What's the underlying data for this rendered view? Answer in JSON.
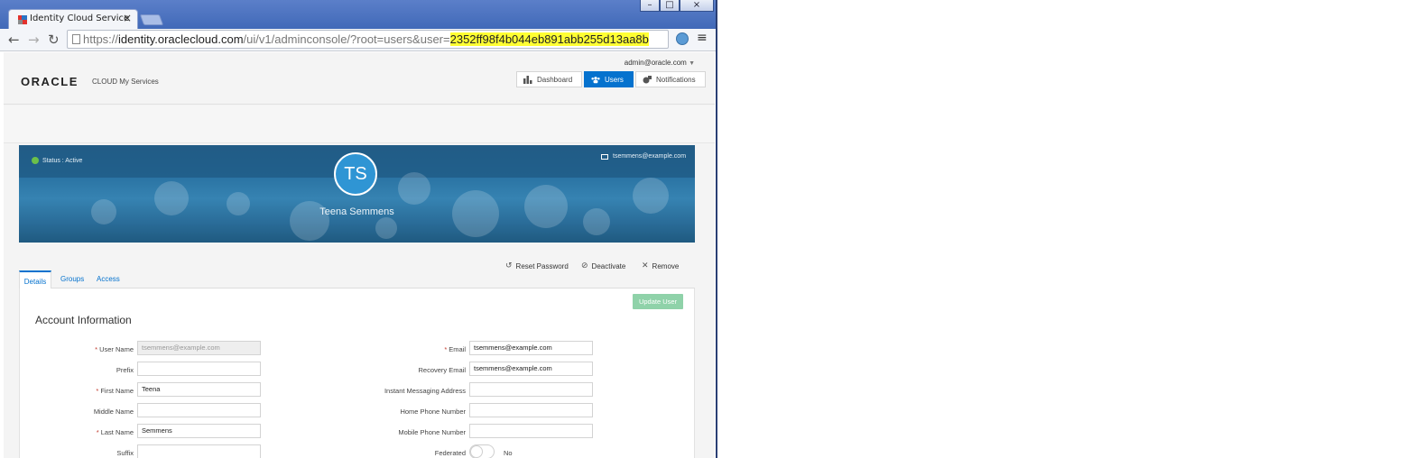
{
  "browser": {
    "tab_title": "Identity Cloud Service",
    "tab_close": "×",
    "url_scheme": "https://",
    "url_host": "identity.oraclecloud.com",
    "url_path": "/ui/v1/adminconsole/?root=users&user=",
    "url_highlight": "2352ff98f4b044eb891abb255d13aa8b",
    "window_controls": [
      "–",
      "□",
      "×"
    ],
    "icons": [
      "back-icon",
      "forward-icon",
      "reload-icon",
      "page-icon",
      "extension-icon",
      "menu-icon"
    ]
  },
  "header": {
    "admin_user": "admin@oracle.com",
    "logo_text": "ORACLE",
    "logo_suffix": "CLOUD My Services",
    "nav": [
      {
        "label": "Dashboard",
        "icon": "bar-chart-icon",
        "active": false
      },
      {
        "label": "Users",
        "icon": "users-icon",
        "active": true
      },
      {
        "label": "Notifications",
        "icon": "notifications-icon",
        "active": false
      }
    ]
  },
  "profile": {
    "status": "Status : Active",
    "email": "tsemmens@example.com",
    "initials": "TS",
    "full_name": "Teena Semmens",
    "accent_color": "#2f95d4"
  },
  "actions": {
    "reset_password": "Reset Password",
    "deactivate": "Deactivate",
    "remove": "Remove"
  },
  "detail_tabs": [
    "Details",
    "Groups",
    "Access"
  ],
  "form": {
    "update_button": "Update User",
    "section_title": "Account Information",
    "left": [
      {
        "label": "User Name",
        "required": true,
        "value": "tsemmens@example.com",
        "disabled": true
      },
      {
        "label": "Prefix",
        "required": false,
        "value": ""
      },
      {
        "label": "First Name",
        "required": true,
        "value": "Teena"
      },
      {
        "label": "Middle Name",
        "required": false,
        "value": ""
      },
      {
        "label": "Last Name",
        "required": true,
        "value": "Semmens"
      },
      {
        "label": "Suffix",
        "required": false,
        "value": ""
      }
    ],
    "right": [
      {
        "label": "Email",
        "required": true,
        "value": "tsemmens@example.com"
      },
      {
        "label": "Recovery Email",
        "required": false,
        "value": "tsemmens@example.com"
      },
      {
        "label": "Instant Messaging Address",
        "required": false,
        "value": ""
      },
      {
        "label": "Home Phone Number",
        "required": false,
        "value": ""
      },
      {
        "label": "Mobile Phone Number",
        "required": false,
        "value": ""
      }
    ],
    "federated_label": "Federated",
    "federated_value": "No",
    "required_mark": "*"
  }
}
